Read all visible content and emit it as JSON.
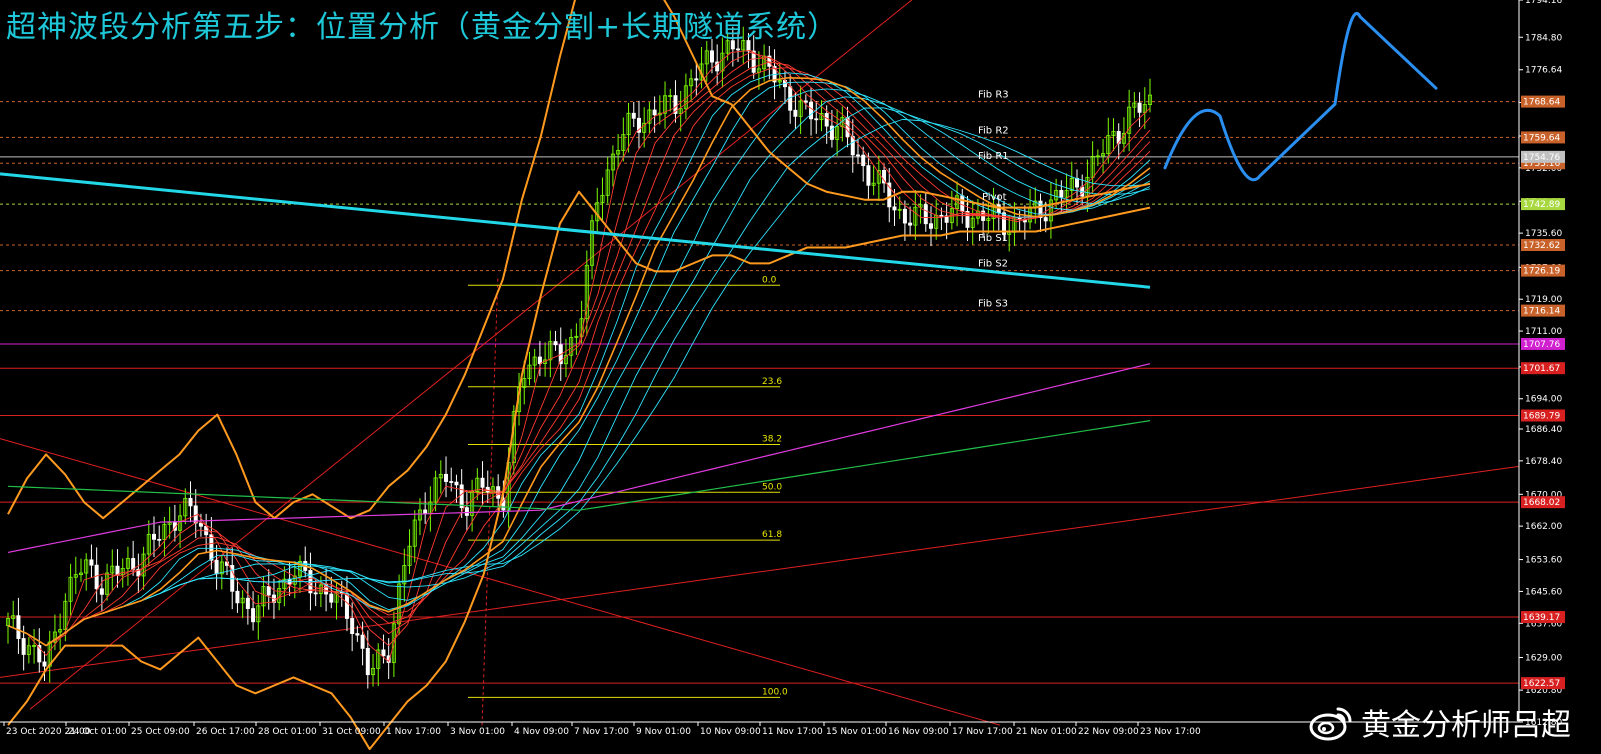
{
  "title": "超神波段分析第五步：位置分析（黄金分割+长期隧道系统）",
  "watermark": {
    "text": "黄金分析师吕超",
    "icon": "weibo-icon"
  },
  "colors": {
    "background": "#000000",
    "bullish_candle": "#7cfc00",
    "bearish_candle": "#ffffff",
    "tunnel_fast": "#ff3b30",
    "tunnel_slow": "#2ee6ff",
    "long_ma": "#22d8e8",
    "bollinger": "#ff9a1f",
    "ma_magenta": "#e03ce0",
    "ma_green": "#22c04a",
    "fib_lines": "#e0e000",
    "forecast": "#2a8ff0",
    "trendline": "#e02020",
    "level_line": "#ff2020"
  },
  "chart_data": {
    "type": "candlestick",
    "symbol": "XAUUSD",
    "ylim": [
      1612.8,
      1794.16
    ],
    "y_ticks": [
      "1794.16",
      "1784.80",
      "1776.64",
      "1768.40",
      "1760.00",
      "1752.00",
      "1743.60",
      "1735.60",
      "1727.00",
      "1719.00",
      "1711.00",
      "1702.00",
      "1694.00",
      "1686.40",
      "1678.40",
      "1670.00",
      "1662.00",
      "1653.60",
      "1645.60",
      "1637.60",
      "1629.00",
      "1620.80",
      "1612.80"
    ],
    "x_labels": [
      "23 Oct 2020 21:00",
      "24 Oct 01:00",
      "25 Oct 09:00",
      "26 Oct 17:00",
      "28 Oct 01:00",
      "31 Oct 09:00",
      "1 Nov 17:00",
      "3 Nov 01:00",
      "4 Nov 09:00",
      "7 Nov 17:00",
      "9 Nov 01:00",
      "10 Nov 09:00",
      "11 Nov 17:00",
      "15 Nov 01:00",
      "16 Nov 09:00",
      "17 Nov 17:00",
      "21 Nov 01:00",
      "22 Nov 09:00",
      "23 Nov 17:00"
    ],
    "price_markers": [
      {
        "value": "1768.64",
        "color": "#c8622a"
      },
      {
        "value": "1759.64",
        "color": "#c8622a"
      },
      {
        "value": "1753.16",
        "color": "#c8622a"
      },
      {
        "value": "1754.76",
        "color": "#c0c0c0"
      },
      {
        "value": "1742.89",
        "color": "#a8d840"
      },
      {
        "value": "1732.62",
        "color": "#c8622a"
      },
      {
        "value": "1726.19",
        "color": "#c8622a"
      },
      {
        "value": "1716.14",
        "color": "#c8622a"
      },
      {
        "value": "1707.76",
        "color": "#d020d0"
      },
      {
        "value": "1701.67",
        "color": "#d82020"
      },
      {
        "value": "1689.79",
        "color": "#d82020"
      },
      {
        "value": "1668.02",
        "color": "#d82020"
      },
      {
        "value": "1639.17",
        "color": "#d82020"
      },
      {
        "value": "1622.57",
        "color": "#d82020"
      }
    ],
    "pivot_levels": [
      {
        "name": "Fib R3",
        "value": 1768.64
      },
      {
        "name": "Fib R2",
        "value": 1759.64
      },
      {
        "name": "Fib R1",
        "value": 1753.16
      },
      {
        "name": "Pivot",
        "value": 1742.89
      },
      {
        "name": "Fib S1",
        "value": 1732.62
      },
      {
        "name": "Fib S2",
        "value": 1726.19
      },
      {
        "name": "Fib S3",
        "value": 1716.14
      }
    ],
    "fibonacci": [
      {
        "label": "0.0",
        "value": 1722.5
      },
      {
        "label": "23.6",
        "value": 1697.0
      },
      {
        "label": "38.2",
        "value": 1682.5
      },
      {
        "label": "50.0",
        "value": 1670.5
      },
      {
        "label": "61.8",
        "value": 1658.5
      },
      {
        "label": "100.0",
        "value": 1619.0
      }
    ],
    "series": [
      {
        "kind": "close",
        "x": [
          0,
          5,
          10,
          15,
          20,
          25,
          30,
          35,
          40,
          45,
          50,
          55,
          60,
          65,
          70,
          75,
          80,
          85,
          90,
          95,
          100,
          105,
          110,
          115,
          120,
          125,
          130,
          135,
          140,
          145,
          150,
          155,
          160,
          165,
          170,
          175,
          180,
          185,
          190,
          195,
          200,
          205,
          210,
          215,
          220,
          225,
          230,
          235,
          240,
          245,
          250,
          255,
          260,
          265,
          270,
          275,
          280,
          285,
          290,
          295,
          300
        ],
        "values": [
          1637,
          1633,
          1626,
          1645,
          1652,
          1648,
          1651,
          1654,
          1660,
          1666,
          1664,
          1652,
          1645,
          1640,
          1646,
          1650,
          1648,
          1644,
          1640,
          1624,
          1632,
          1656,
          1670,
          1674,
          1668,
          1672,
          1669,
          1700,
          1706,
          1704,
          1712,
          1745,
          1758,
          1764,
          1766,
          1768,
          1774,
          1780,
          1782,
          1781,
          1776,
          1770,
          1765,
          1764,
          1760,
          1752,
          1746,
          1740,
          1739,
          1740,
          1741,
          1740,
          1739,
          1738,
          1741,
          1744,
          1747,
          1752,
          1760,
          1765,
          1769
        ]
      },
      {
        "kind": "bollinger_upper",
        "values": [
          1665,
          1674,
          1680,
          1675,
          1668,
          1664,
          1668,
          1672,
          1676,
          1680,
          1686,
          1690,
          1680,
          1668,
          1664,
          1668,
          1670,
          1667,
          1664,
          1666,
          1672,
          1676,
          1682,
          1690,
          1700,
          1712,
          1724,
          1744,
          1760,
          1780,
          1798,
          1804,
          1806,
          1802,
          1798,
          1790,
          1780,
          1770,
          1768,
          1762,
          1756,
          1752,
          1748,
          1746,
          1745,
          1744,
          1744,
          1746,
          1746,
          1745,
          1744,
          1743,
          1742,
          1742,
          1742,
          1743,
          1744,
          1745,
          1746,
          1747,
          1748
        ]
      },
      {
        "kind": "bollinger_lower",
        "values": [
          1612,
          1618,
          1626,
          1632,
          1632,
          1632,
          1632,
          1628,
          1626,
          1630,
          1634,
          1628,
          1622,
          1620,
          1622,
          1624,
          1622,
          1620,
          1614,
          1606,
          1612,
          1618,
          1622,
          1628,
          1638,
          1650,
          1670,
          1700,
          1720,
          1738,
          1746,
          1740,
          1734,
          1728,
          1726,
          1726,
          1728,
          1730,
          1730,
          1728,
          1728,
          1730,
          1732,
          1732,
          1732,
          1733,
          1734,
          1735,
          1735,
          1735,
          1736,
          1736,
          1736,
          1736,
          1736,
          1737,
          1738,
          1739,
          1740,
          1741,
          1742
        ]
      }
    ],
    "long_ma": {
      "start": 1750.5,
      "end": 1722.0
    },
    "forecast": [
      1752,
      1765,
      1750,
      1768,
      1790,
      1772
    ]
  }
}
